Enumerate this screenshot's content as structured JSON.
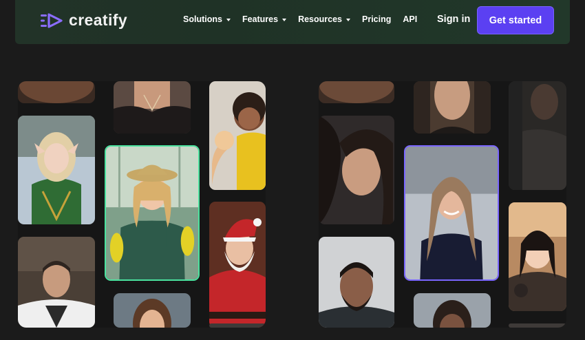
{
  "brand": {
    "name": "creatify",
    "logo_icon": "creatify-logo-icon"
  },
  "nav": {
    "items": [
      {
        "label": "Solutions",
        "has_dropdown": true
      },
      {
        "label": "Features",
        "has_dropdown": true
      },
      {
        "label": "Resources",
        "has_dropdown": true
      },
      {
        "label": "Pricing",
        "has_dropdown": false
      },
      {
        "label": "API",
        "has_dropdown": false
      }
    ],
    "signin_label": "Sign in",
    "cta_label": "Get started"
  },
  "colors": {
    "accent": "#5b40f2",
    "highlight_green": "#4be39f",
    "highlight_purple": "#7a66ff",
    "background": "#1b1b1b"
  }
}
